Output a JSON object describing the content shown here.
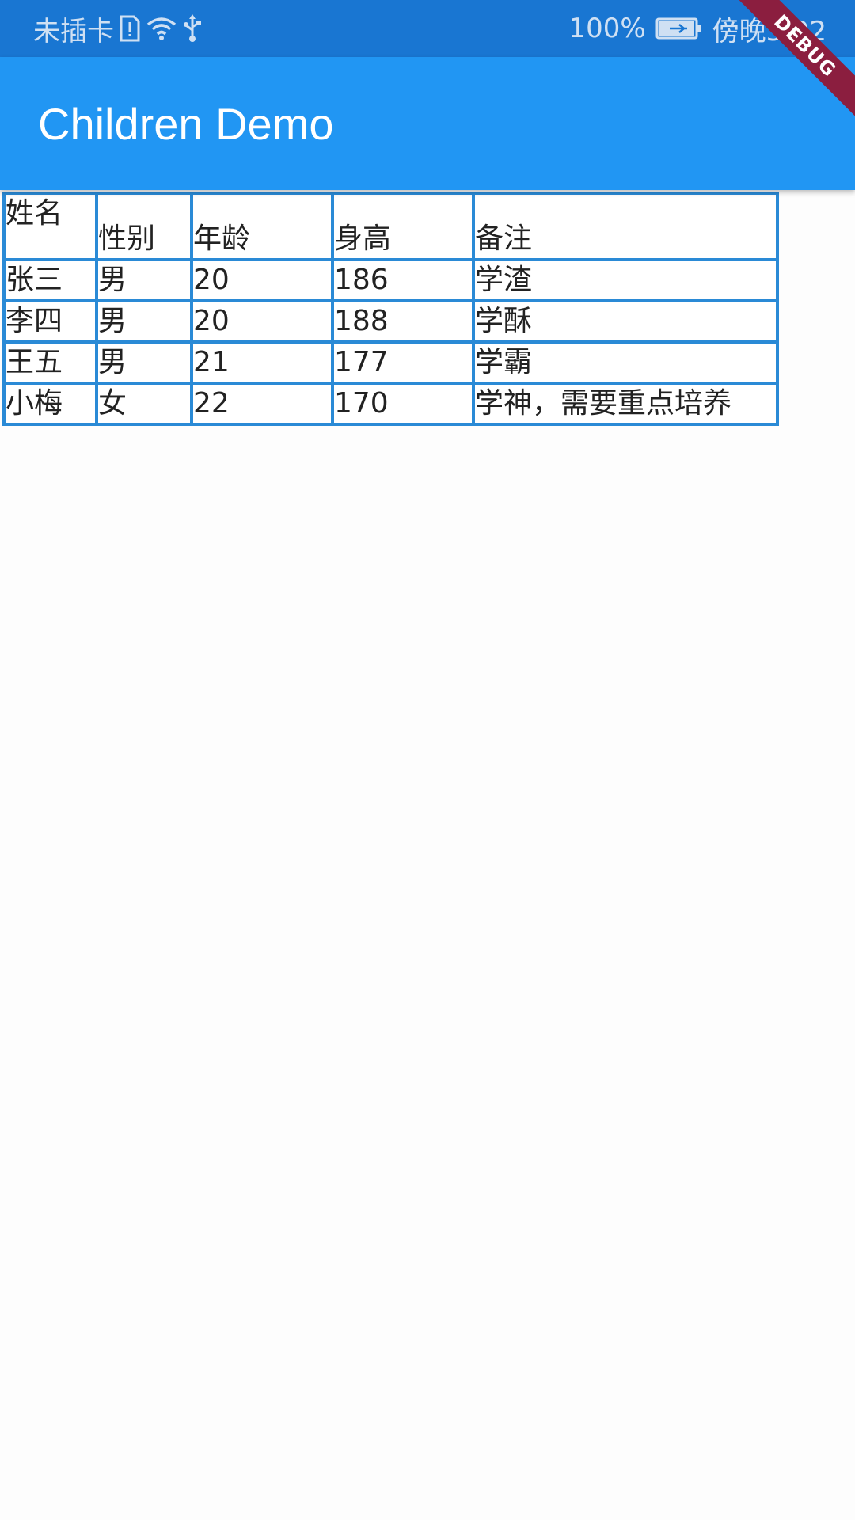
{
  "status_bar": {
    "carrier": "未插卡",
    "battery": "100%",
    "time": "傍晚5:02",
    "icons": [
      "sim-alert-icon",
      "wifi-icon",
      "usb-icon",
      "battery-charging-icon"
    ]
  },
  "app_bar": {
    "title": "Children Demo",
    "color": "#2196f3"
  },
  "debug_banner": {
    "label": "DEBUG",
    "color": "#8b1e3f"
  },
  "table": {
    "border_color": "#2a8ad6",
    "headers": [
      "姓名",
      "性别",
      "年龄",
      "身高",
      "备注"
    ],
    "rows": [
      [
        "张三",
        "男",
        "20",
        "186",
        "学渣"
      ],
      [
        "李四",
        "男",
        "20",
        "188",
        "学酥"
      ],
      [
        "王五",
        "男",
        "21",
        "177",
        "学霸"
      ],
      [
        "小梅",
        "女",
        "22",
        "170",
        "学神，需要重点培养"
      ]
    ]
  }
}
